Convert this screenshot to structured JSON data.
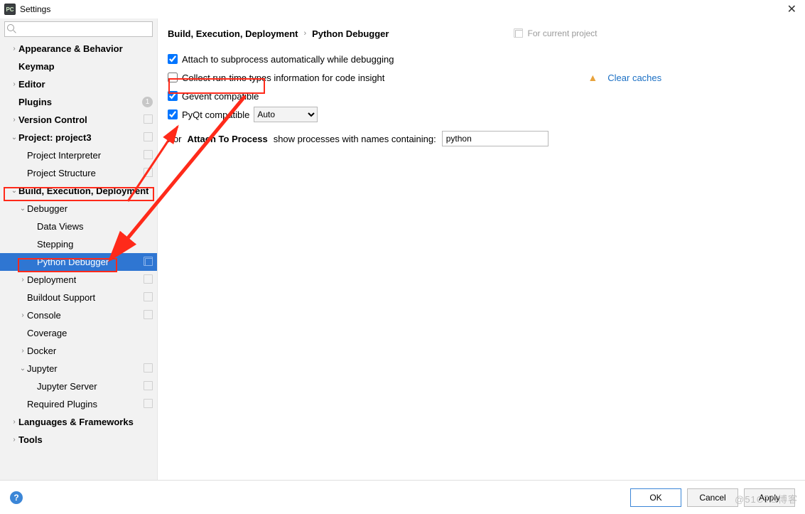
{
  "window": {
    "title": "Settings",
    "close": "✕"
  },
  "search": {
    "placeholder": ""
  },
  "sidebar": {
    "items": [
      {
        "label": "Appearance & Behavior",
        "bold": true,
        "chev": "›",
        "ind": 1
      },
      {
        "label": "Keymap",
        "bold": true,
        "chev": "",
        "ind": 1
      },
      {
        "label": "Editor",
        "bold": true,
        "chev": "›",
        "ind": 1
      },
      {
        "label": "Plugins",
        "bold": true,
        "chev": "",
        "ind": 1,
        "badge": "1"
      },
      {
        "label": "Version Control",
        "bold": true,
        "chev": "›",
        "ind": 1,
        "copy": true
      },
      {
        "label": "Project: project3",
        "bold": true,
        "chev": "⌄",
        "ind": 1,
        "copy": true
      },
      {
        "label": "Project Interpreter",
        "bold": false,
        "chev": "",
        "ind": 2,
        "copy": true
      },
      {
        "label": "Project Structure",
        "bold": false,
        "chev": "",
        "ind": 2,
        "copy": true
      },
      {
        "label": "Build, Execution, Deployment",
        "bold": true,
        "chev": "⌄",
        "ind": 1
      },
      {
        "label": "Debugger",
        "bold": false,
        "chev": "⌄",
        "ind": 2
      },
      {
        "label": "Data Views",
        "bold": false,
        "chev": "",
        "ind": 3
      },
      {
        "label": "Stepping",
        "bold": false,
        "chev": "",
        "ind": 3
      },
      {
        "label": "Python Debugger",
        "bold": false,
        "chev": "",
        "ind": 3,
        "sel": true,
        "copy": true
      },
      {
        "label": "Deployment",
        "bold": false,
        "chev": "›",
        "ind": 2,
        "copy": true
      },
      {
        "label": "Buildout Support",
        "bold": false,
        "chev": "",
        "ind": 2,
        "copy": true
      },
      {
        "label": "Console",
        "bold": false,
        "chev": "›",
        "ind": 2,
        "copy": true
      },
      {
        "label": "Coverage",
        "bold": false,
        "chev": "",
        "ind": 2
      },
      {
        "label": "Docker",
        "bold": false,
        "chev": "›",
        "ind": 2
      },
      {
        "label": "Jupyter",
        "bold": false,
        "chev": "⌄",
        "ind": 2,
        "copy": true
      },
      {
        "label": "Jupyter Server",
        "bold": false,
        "chev": "",
        "ind": 3,
        "copy": true
      },
      {
        "label": "Required Plugins",
        "bold": false,
        "chev": "",
        "ind": 2,
        "copy": true
      },
      {
        "label": "Languages & Frameworks",
        "bold": true,
        "chev": "›",
        "ind": 1
      },
      {
        "label": "Tools",
        "bold": true,
        "chev": "›",
        "ind": 1
      }
    ]
  },
  "breadcrumb": {
    "a": "Build, Execution, Deployment",
    "sep": "›",
    "b": "Python Debugger",
    "hint": "For current project"
  },
  "options": {
    "attach": {
      "label": "Attach to subprocess automatically while debugging",
      "checked": true
    },
    "collect": {
      "label": "Collect run-time types information for code insight",
      "checked": false
    },
    "gevent": {
      "label": "Gevent compatible",
      "checked": true
    },
    "pyqt": {
      "label": "PyQt compatible",
      "checked": true,
      "select": "Auto"
    },
    "clear": {
      "warn": "▲",
      "link": "Clear caches"
    },
    "process": {
      "pre": "For",
      "bold": "Attach To Process",
      "post": "show processes with names containing:",
      "value": "python"
    }
  },
  "footer": {
    "ok": "OK",
    "cancel": "Cancel",
    "apply": "Apply"
  },
  "watermark": "@51CTO博客"
}
